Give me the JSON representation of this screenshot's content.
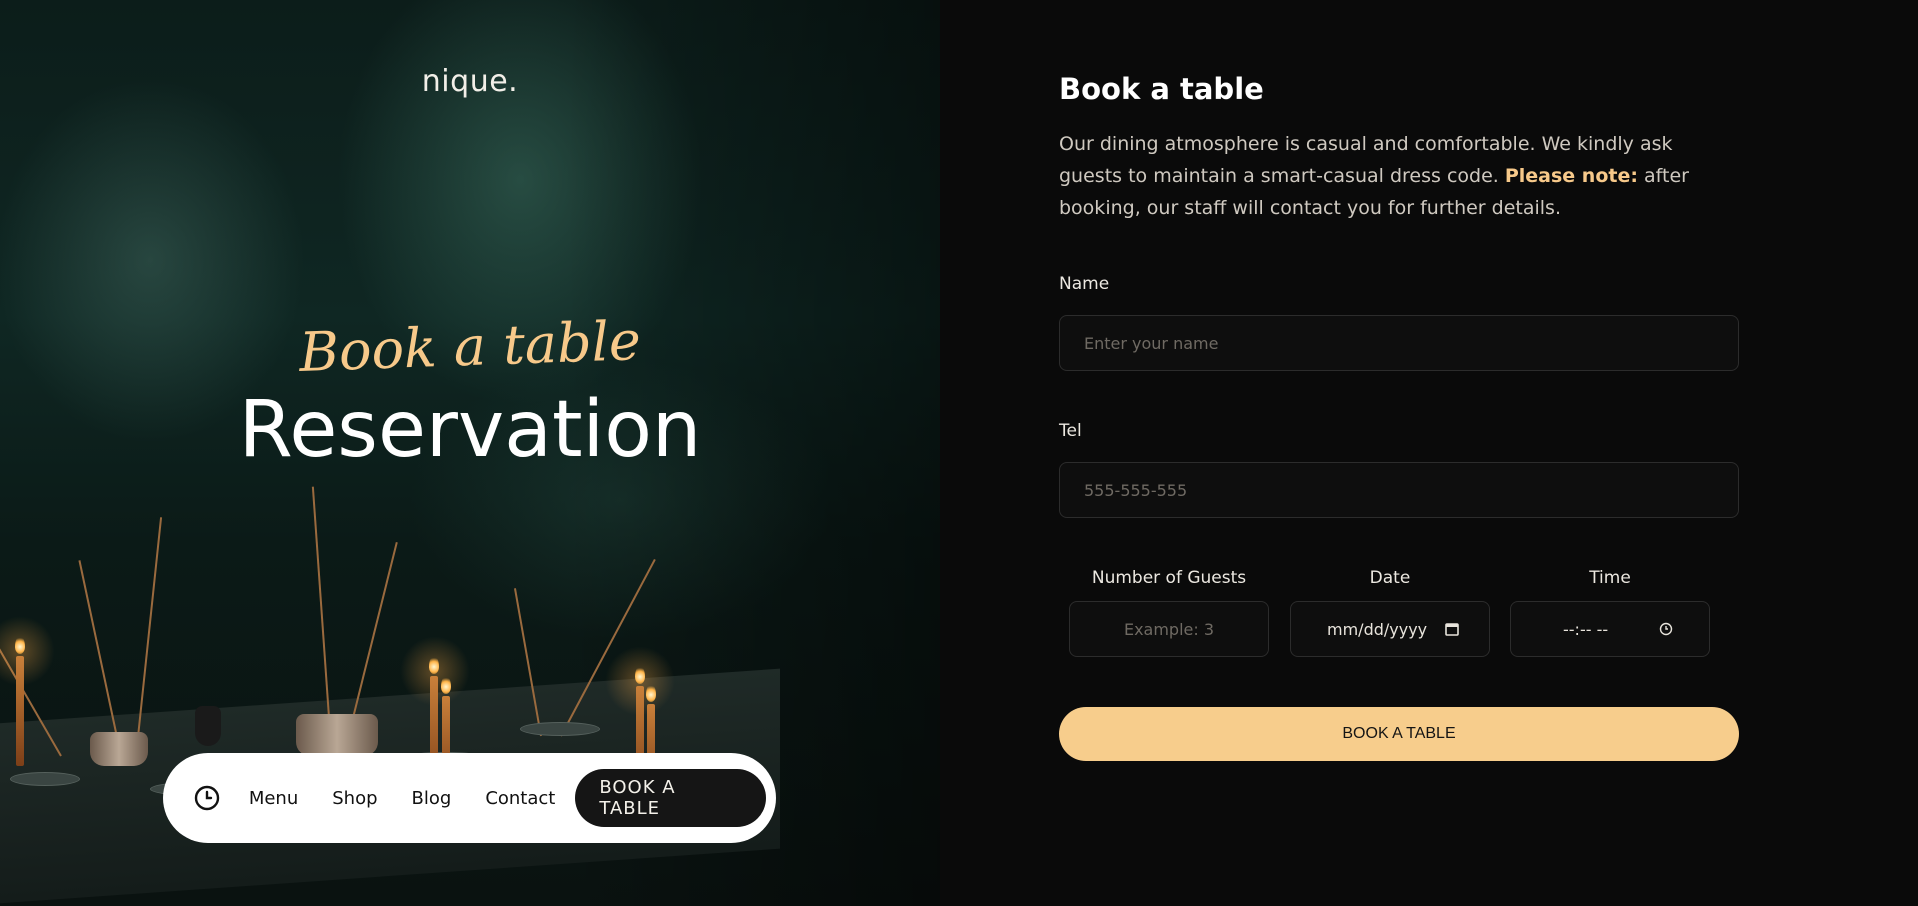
{
  "hero": {
    "logo": "nique.",
    "script_title": "Book a table",
    "title": "Reservation"
  },
  "nav": {
    "icon": "clock-icon",
    "links": [
      "Menu",
      "Shop",
      "Blog",
      "Contact"
    ],
    "cta": "BOOK A TABLE"
  },
  "form": {
    "title": "Book a table",
    "intro_before": "Our dining atmosphere is casual and comfortable. We kindly ask guests to maintain a smart-casual dress code. ",
    "intro_note": "Please note:",
    "intro_after": " after booking, our staff will contact you for further details.",
    "name": {
      "label": "Name",
      "placeholder": "Enter your name"
    },
    "tel": {
      "label": "Tel",
      "placeholder": "555-555-555"
    },
    "guests": {
      "label": "Number of Guests",
      "placeholder": "Example: 3"
    },
    "date": {
      "label": "Date",
      "value": "mm/dd/yyyy",
      "icon": "calendar-icon"
    },
    "time": {
      "label": "Time",
      "value": "--:-- --",
      "icon": "clock-icon"
    },
    "submit": "BOOK A TABLE"
  },
  "colors": {
    "accent": "#f7cd8c",
    "background": "#0a0a0a",
    "nav_pill": "#ffffff"
  }
}
